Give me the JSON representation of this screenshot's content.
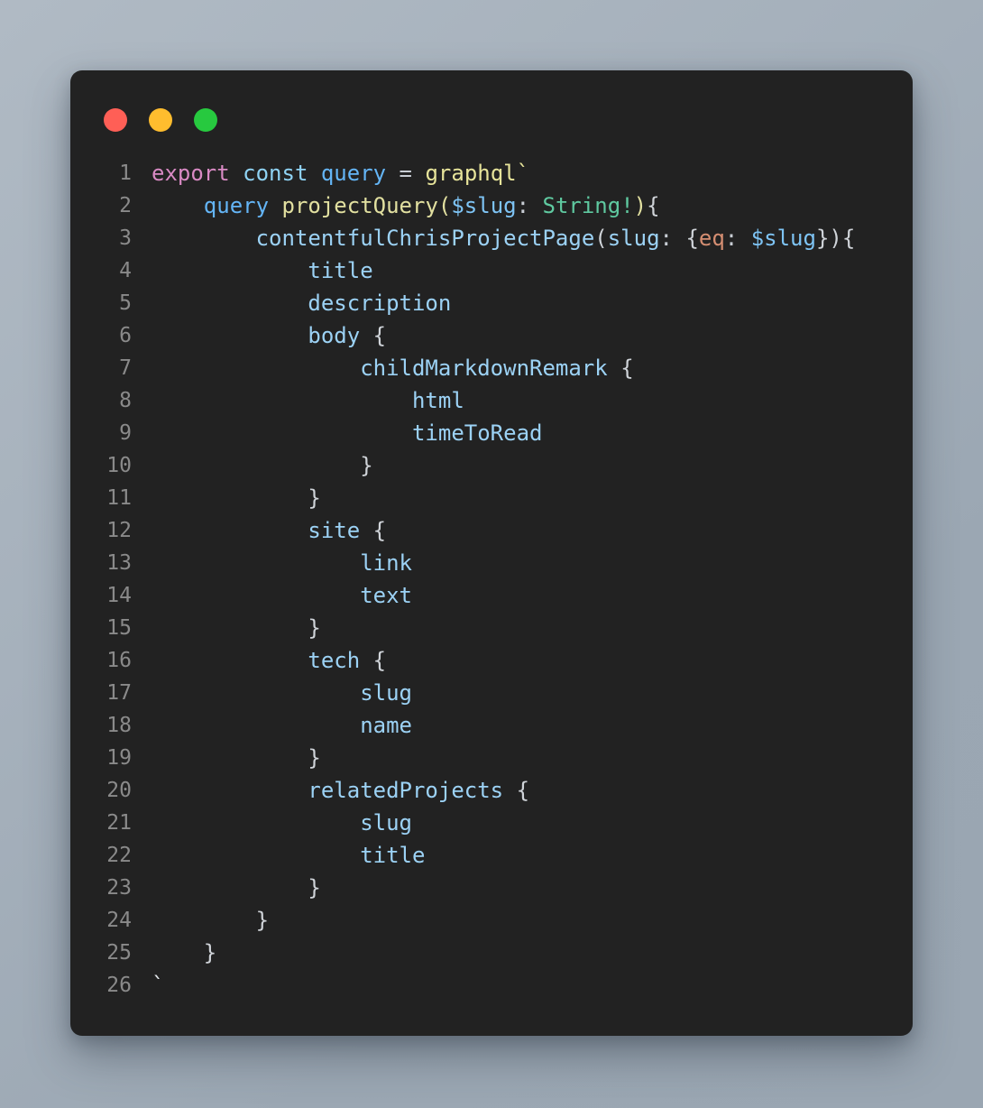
{
  "window": {
    "title": "code-snippet",
    "background_gradient_from": "#b0bac4",
    "background_gradient_to": "#9aa6b2",
    "surface_color": "#222222",
    "traffic_lights": [
      {
        "name": "close",
        "label": "Close",
        "color": "#ff5f56"
      },
      {
        "name": "minimize",
        "label": "Minimize",
        "color": "#ffbd2e"
      },
      {
        "name": "maximize",
        "label": "Maximize",
        "color": "#27c93f"
      }
    ]
  },
  "editor": {
    "language": "graphql",
    "font_size_px": 24,
    "line_height_px": 36,
    "gutter_color": "#8a8a8a",
    "line_numbers": [
      "1",
      "2",
      "3",
      "4",
      "5",
      "6",
      "7",
      "8",
      "9",
      "10",
      "11",
      "12",
      "13",
      "14",
      "15",
      "16",
      "17",
      "18",
      "19",
      "20",
      "21",
      "22",
      "23",
      "24",
      "25",
      "26"
    ],
    "lines": [
      {
        "n": "1",
        "plain": "export const query = graphql`"
      },
      {
        "n": "2",
        "plain": "    query projectQuery($slug: String!){"
      },
      {
        "n": "3",
        "plain": "        contentfulChrisProjectPage(slug: {eq: $slug}){"
      },
      {
        "n": "4",
        "plain": "            title"
      },
      {
        "n": "5",
        "plain": "            description"
      },
      {
        "n": "6",
        "plain": "            body {"
      },
      {
        "n": "7",
        "plain": "                childMarkdownRemark {"
      },
      {
        "n": "8",
        "plain": "                    html"
      },
      {
        "n": "9",
        "plain": "                    timeToRead"
      },
      {
        "n": "10",
        "plain": "                }"
      },
      {
        "n": "11",
        "plain": "            }"
      },
      {
        "n": "12",
        "plain": "            site {"
      },
      {
        "n": "13",
        "plain": "                link"
      },
      {
        "n": "14",
        "plain": "                text"
      },
      {
        "n": "15",
        "plain": "            }"
      },
      {
        "n": "16",
        "plain": "            tech {"
      },
      {
        "n": "17",
        "plain": "                slug"
      },
      {
        "n": "18",
        "plain": "                name"
      },
      {
        "n": "19",
        "plain": "            }"
      },
      {
        "n": "20",
        "plain": "            relatedProjects {"
      },
      {
        "n": "21",
        "plain": "                slug"
      },
      {
        "n": "22",
        "plain": "                title"
      },
      {
        "n": "23",
        "plain": "            }"
      },
      {
        "n": "24",
        "plain": "        }"
      },
      {
        "n": "25",
        "plain": "    }"
      },
      {
        "n": "26",
        "plain": "`"
      }
    ],
    "tokens": [
      [
        {
          "t": "export",
          "c": "tok-keyword"
        },
        {
          "t": " ",
          "c": "tok-op"
        },
        {
          "t": "const",
          "c": "tok-const"
        },
        {
          "t": " ",
          "c": "tok-op"
        },
        {
          "t": "query",
          "c": "tok-query"
        },
        {
          "t": " = ",
          "c": "tok-op"
        },
        {
          "t": "graphql`",
          "c": "tok-string"
        }
      ],
      [
        {
          "t": "    ",
          "c": "tok-op"
        },
        {
          "t": "query",
          "c": "tok-query"
        },
        {
          "t": " ",
          "c": "tok-op"
        },
        {
          "t": "projectQuery(",
          "c": "tok-fn"
        },
        {
          "t": "$slug",
          "c": "tok-var"
        },
        {
          "t": ": ",
          "c": "tok-op"
        },
        {
          "t": "String!",
          "c": "tok-type"
        },
        {
          "t": ")",
          "c": "tok-fn"
        },
        {
          "t": "{",
          "c": "tok-punct"
        }
      ],
      [
        {
          "t": "        ",
          "c": "tok-op"
        },
        {
          "t": "contentfulChrisProjectPage",
          "c": "tok-field"
        },
        {
          "t": "(",
          "c": "tok-punct"
        },
        {
          "t": "slug",
          "c": "tok-field"
        },
        {
          "t": ": ",
          "c": "tok-op"
        },
        {
          "t": "{",
          "c": "tok-punct"
        },
        {
          "t": "eq",
          "c": "tok-arg"
        },
        {
          "t": ": ",
          "c": "tok-op"
        },
        {
          "t": "$slug",
          "c": "tok-var"
        },
        {
          "t": "}",
          "c": "tok-punct"
        },
        {
          "t": ")",
          "c": "tok-punct"
        },
        {
          "t": "{",
          "c": "tok-punct"
        }
      ],
      [
        {
          "t": "            ",
          "c": "tok-op"
        },
        {
          "t": "title",
          "c": "tok-field"
        }
      ],
      [
        {
          "t": "            ",
          "c": "tok-op"
        },
        {
          "t": "description",
          "c": "tok-field"
        }
      ],
      [
        {
          "t": "            ",
          "c": "tok-op"
        },
        {
          "t": "body",
          "c": "tok-field"
        },
        {
          "t": " ",
          "c": "tok-op"
        },
        {
          "t": "{",
          "c": "tok-punct"
        }
      ],
      [
        {
          "t": "                ",
          "c": "tok-op"
        },
        {
          "t": "childMarkdownRemark",
          "c": "tok-field"
        },
        {
          "t": " ",
          "c": "tok-op"
        },
        {
          "t": "{",
          "c": "tok-punct"
        }
      ],
      [
        {
          "t": "                    ",
          "c": "tok-op"
        },
        {
          "t": "html",
          "c": "tok-field"
        }
      ],
      [
        {
          "t": "                    ",
          "c": "tok-op"
        },
        {
          "t": "timeToRead",
          "c": "tok-field"
        }
      ],
      [
        {
          "t": "                ",
          "c": "tok-op"
        },
        {
          "t": "}",
          "c": "tok-punct"
        }
      ],
      [
        {
          "t": "            ",
          "c": "tok-op"
        },
        {
          "t": "}",
          "c": "tok-punct"
        }
      ],
      [
        {
          "t": "            ",
          "c": "tok-op"
        },
        {
          "t": "site",
          "c": "tok-field"
        },
        {
          "t": " ",
          "c": "tok-op"
        },
        {
          "t": "{",
          "c": "tok-punct"
        }
      ],
      [
        {
          "t": "                ",
          "c": "tok-op"
        },
        {
          "t": "link",
          "c": "tok-field"
        }
      ],
      [
        {
          "t": "                ",
          "c": "tok-op"
        },
        {
          "t": "text",
          "c": "tok-field"
        }
      ],
      [
        {
          "t": "            ",
          "c": "tok-op"
        },
        {
          "t": "}",
          "c": "tok-punct"
        }
      ],
      [
        {
          "t": "            ",
          "c": "tok-op"
        },
        {
          "t": "tech",
          "c": "tok-field"
        },
        {
          "t": " ",
          "c": "tok-op"
        },
        {
          "t": "{",
          "c": "tok-punct"
        }
      ],
      [
        {
          "t": "                ",
          "c": "tok-op"
        },
        {
          "t": "slug",
          "c": "tok-field"
        }
      ],
      [
        {
          "t": "                ",
          "c": "tok-op"
        },
        {
          "t": "name",
          "c": "tok-field"
        }
      ],
      [
        {
          "t": "            ",
          "c": "tok-op"
        },
        {
          "t": "}",
          "c": "tok-punct"
        }
      ],
      [
        {
          "t": "            ",
          "c": "tok-op"
        },
        {
          "t": "relatedProjects",
          "c": "tok-field"
        },
        {
          "t": " ",
          "c": "tok-op"
        },
        {
          "t": "{",
          "c": "tok-punct"
        }
      ],
      [
        {
          "t": "                ",
          "c": "tok-op"
        },
        {
          "t": "slug",
          "c": "tok-field"
        }
      ],
      [
        {
          "t": "                ",
          "c": "tok-op"
        },
        {
          "t": "title",
          "c": "tok-field"
        }
      ],
      [
        {
          "t": "            ",
          "c": "tok-op"
        },
        {
          "t": "}",
          "c": "tok-punct"
        }
      ],
      [
        {
          "t": "        ",
          "c": "tok-op"
        },
        {
          "t": "}",
          "c": "tok-punct"
        }
      ],
      [
        {
          "t": "    ",
          "c": "tok-op"
        },
        {
          "t": "}",
          "c": "tok-punct"
        }
      ],
      [
        {
          "t": "`",
          "c": "tok-tick"
        }
      ]
    ]
  }
}
